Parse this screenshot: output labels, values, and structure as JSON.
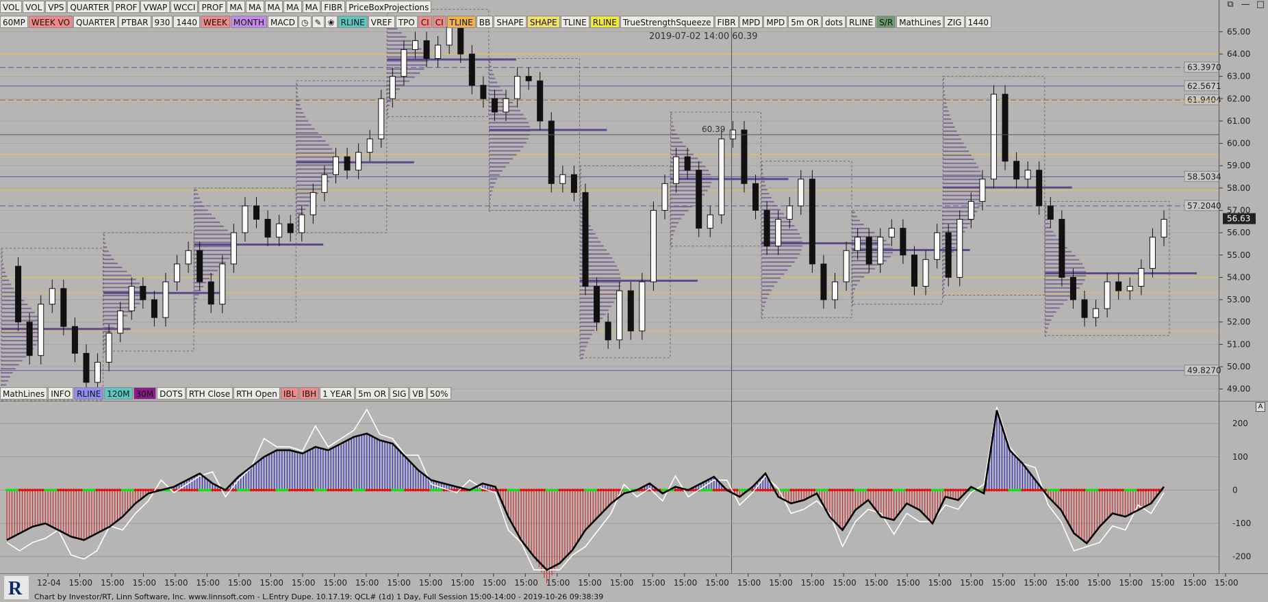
{
  "window_controls": [
    "⧉",
    "—",
    "□"
  ],
  "toolbar_row1": [
    "VOL",
    "VOL",
    "VPS",
    "QUARTER",
    "PROF",
    "VWAP",
    "WCCI",
    "PROF",
    "MA",
    "MA",
    "MA",
    "MA",
    "MA",
    "FIBR",
    "PriceBoxProjections"
  ],
  "toolbar_row2": [
    {
      "label": "60MP",
      "color": "#ecebe6"
    },
    {
      "label": "WEEK VO",
      "color": "#f08a8a"
    },
    {
      "label": "QUARTER",
      "color": "#ecebe6"
    },
    {
      "label": "PTBAR",
      "color": "#ecebe6"
    },
    {
      "label": "930",
      "color": "#ecebe6"
    },
    {
      "label": "1440",
      "color": "#ecebe6"
    },
    {
      "label": "WEEK",
      "color": "#f08a8a"
    },
    {
      "label": "MONTH",
      "color": "#c58ae8"
    },
    {
      "label": "MACD",
      "color": "#ecebe6"
    },
    {
      "label": "◷",
      "color": "#ecebe6",
      "icon": "clock-icon"
    },
    {
      "label": "✎",
      "color": "#ecebe6",
      "icon": "pencil-icon"
    },
    {
      "label": "❀",
      "color": "#ecebe6",
      "icon": "refresh-icon"
    },
    {
      "label": "RLINE",
      "color": "#5cc6c0"
    },
    {
      "label": "VREF",
      "color": "#ecebe6"
    },
    {
      "label": "TPO",
      "color": "#ecebe6"
    },
    {
      "label": "CI",
      "color": "#f08a8a"
    },
    {
      "label": "CI",
      "color": "#f08a8a"
    },
    {
      "label": "TLINE",
      "color": "#f2b24a"
    },
    {
      "label": "BB",
      "color": "#ecebe6"
    },
    {
      "label": "SHAPE",
      "color": "#ecebe6"
    },
    {
      "label": "SHAPE",
      "color": "#f2e06a"
    },
    {
      "label": "TLINE",
      "color": "#ecebe6"
    },
    {
      "label": "RLINE",
      "color": "#f2ea3a"
    },
    {
      "label": "TrueStrengthSqueeze",
      "color": "#ecebe6"
    },
    {
      "label": "FIBR",
      "color": "#ecebe6"
    },
    {
      "label": "MPD",
      "color": "#ecebe6"
    },
    {
      "label": "MPD",
      "color": "#ecebe6"
    },
    {
      "label": "5m OR",
      "color": "#ecebe6"
    },
    {
      "label": "dots",
      "color": "#ecebe6"
    },
    {
      "label": "RLINE",
      "color": "#ecebe6"
    },
    {
      "label": "S/R",
      "color": "#6f9a6f"
    },
    {
      "label": "MathLines",
      "color": "#ecebe6"
    },
    {
      "label": "ZIG",
      "color": "#ecebe6"
    },
    {
      "label": "1440",
      "color": "#ecebe6"
    }
  ],
  "toolbar_row3": [
    {
      "label": "MathLines",
      "color": "#ecebe6"
    },
    {
      "label": "INFO",
      "color": "#ecebe6"
    },
    {
      "label": "RLINE",
      "color": "#8f8ff0"
    },
    {
      "label": "120M",
      "color": "#5cc6c0"
    },
    {
      "label": "30M",
      "color": "#8a1a8a"
    },
    {
      "label": "DOTS",
      "color": "#ecebe6"
    },
    {
      "label": "RTH Close",
      "color": "#ecebe6"
    },
    {
      "label": "RTH Open",
      "color": "#ecebe6"
    },
    {
      "label": "IBL",
      "color": "#f08a8a"
    },
    {
      "label": "IBH",
      "color": "#f08a8a"
    },
    {
      "label": "1 YEAR",
      "color": "#ecebe6"
    },
    {
      "label": "5m OR",
      "color": "#ecebe6"
    },
    {
      "label": "SIG",
      "color": "#ecebe6"
    },
    {
      "label": "VB",
      "color": "#ecebe6"
    },
    {
      "label": "50%",
      "color": "#ecebe6"
    }
  ],
  "crosshair_label": "2019-07-02 14:00  60.39",
  "footer_text": "Chart by Investor/RT, Linn Software, Inc. www.linnsoft.com - L.Entry Dupe.   10.17.19: QCL# (1d) 1 Day, Full Session 15:00-14:00 - 2019-10-26 09:38:39",
  "panel_marker": "A",
  "chart_data": [
    {
      "type": "candlestick",
      "instrument": "QCL#",
      "price_axis": {
        "min": 48.5,
        "max": 65.5,
        "ticks": [
          "65.00",
          "64.00",
          "63.00",
          "62.00",
          "61.00",
          "60.00",
          "59.00",
          "58.00",
          "57.00",
          "56.00",
          "55.00",
          "54.00",
          "53.00",
          "52.00",
          "51.00",
          "50.00",
          "49.00"
        ]
      },
      "last_price": "56.63",
      "crosshair_price": "60.39",
      "level_labels": [
        "63.3970",
        "62.5671",
        "61.9404",
        "58.5034",
        "57.2040",
        "49.8270"
      ],
      "level_values": [
        63.397,
        62.5671,
        61.9404,
        58.5034,
        57.204,
        49.827
      ],
      "time_axis_labels": [
        "12-04",
        "15:00",
        "15:00",
        "15:00",
        "15:00",
        "15:00",
        "15:00",
        "15:00",
        "15:00",
        "15:00",
        "15:00",
        "15:00",
        "15:00",
        "15:00",
        "15:00",
        "15:00",
        "15:00",
        "15:00",
        "15:00",
        "15:00",
        "15:00",
        "15:00",
        "15:00",
        "15:00",
        "15:00",
        "15:00",
        "15:00",
        "15:00",
        "15:00",
        "15:00",
        "15:00",
        "15:00",
        "15:00",
        "15:00",
        "15:00",
        "15:00",
        "15:00",
        "15:00"
      ],
      "close_path": [
        54.5,
        52.0,
        50.5,
        52.8,
        53.5,
        51.8,
        50.6,
        49.3,
        50.2,
        51.5,
        52.5,
        53.6,
        53.0,
        52.2,
        53.8,
        54.6,
        55.2,
        53.8,
        52.8,
        54.6,
        56.0,
        57.2,
        56.6,
        55.8,
        56.4,
        56.0,
        56.8,
        57.8,
        58.6,
        59.4,
        58.8,
        59.6,
        60.2,
        62.0,
        63.0,
        64.2,
        64.6,
        63.8,
        64.4,
        65.2,
        64.0,
        62.6,
        62.0,
        61.4,
        62.0,
        63.0,
        62.8,
        61.0,
        58.2,
        58.6,
        57.8,
        53.6,
        52.0,
        51.2,
        53.4,
        51.6,
        53.8,
        57.0,
        58.2,
        59.4,
        58.8,
        56.2,
        56.8,
        60.2,
        60.6,
        58.2,
        57.0,
        55.4,
        56.6,
        57.2,
        58.4,
        54.6,
        53.0,
        53.8,
        55.2,
        55.8,
        54.6,
        55.8,
        56.2,
        55.0,
        53.6,
        54.8,
        56.0,
        54.0,
        56.6,
        57.4,
        58.4,
        62.2,
        59.2,
        58.4,
        58.8,
        57.2,
        56.6,
        54.0,
        53.0,
        52.2,
        52.6,
        53.8,
        53.4,
        53.6,
        54.4,
        55.8,
        56.6
      ]
    },
    {
      "type": "line",
      "name": "TrueStrengthSqueeze",
      "y_axis": {
        "min": -250,
        "max": 260,
        "ticks": [
          "200",
          "100",
          "0",
          "-100",
          "-200"
        ]
      },
      "black_line": [
        -150,
        -130,
        -110,
        -100,
        -120,
        -140,
        -150,
        -130,
        -110,
        -80,
        -40,
        -10,
        0,
        10,
        30,
        50,
        20,
        0,
        40,
        70,
        100,
        120,
        120,
        110,
        130,
        120,
        140,
        160,
        170,
        150,
        140,
        100,
        60,
        30,
        20,
        10,
        0,
        20,
        10,
        -80,
        -150,
        -200,
        -280,
        -220,
        -180,
        -120,
        -80,
        -40,
        -10,
        0,
        20,
        -10,
        10,
        0,
        20,
        40,
        0,
        -20,
        10,
        50,
        -20,
        -40,
        -30,
        -10,
        -80,
        -120,
        -60,
        -30,
        -80,
        -90,
        -40,
        -60,
        -100,
        -20,
        -30,
        10,
        -10,
        240,
        120,
        80,
        30,
        -20,
        -60,
        -130,
        -160,
        -110,
        -70,
        -80,
        -60,
        -40,
        10
      ]
    }
  ]
}
